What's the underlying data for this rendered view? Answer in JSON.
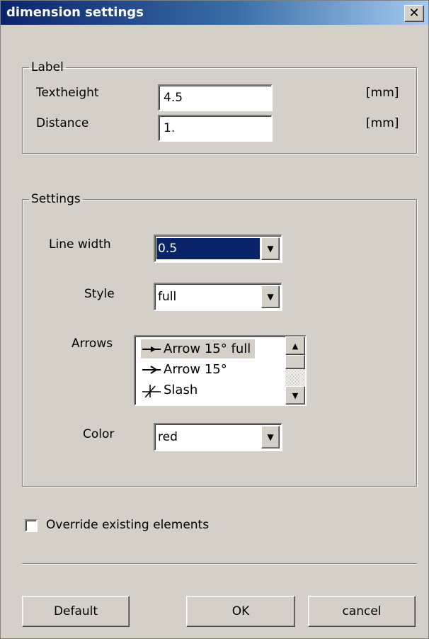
{
  "window": {
    "title": "dimension settings",
    "close_glyph": "✕"
  },
  "label_group": {
    "legend": "Label",
    "textheight": {
      "label": "Textheight",
      "value": "4.5",
      "unit": "[mm]"
    },
    "distance": {
      "label": "Distance",
      "value": "1.",
      "unit": "[mm]"
    }
  },
  "settings_group": {
    "legend": "Settings",
    "line_width": {
      "label": "Line width",
      "value": "0.5"
    },
    "style": {
      "label": "Style",
      "value": "full"
    },
    "arrows": {
      "label": "Arrows",
      "items": [
        {
          "label": "Arrow 15° full",
          "icon": "arrow-full-icon",
          "selected": true
        },
        {
          "label": "Arrow 15°",
          "icon": "arrow-open-icon",
          "selected": false
        },
        {
          "label": "Slash",
          "icon": "slash-icon",
          "selected": false
        }
      ]
    },
    "color": {
      "label": "Color",
      "value": "red"
    }
  },
  "override": {
    "label": "Override existing elements",
    "checked": false
  },
  "buttons": {
    "default": "Default",
    "ok": "OK",
    "cancel": "cancel"
  }
}
